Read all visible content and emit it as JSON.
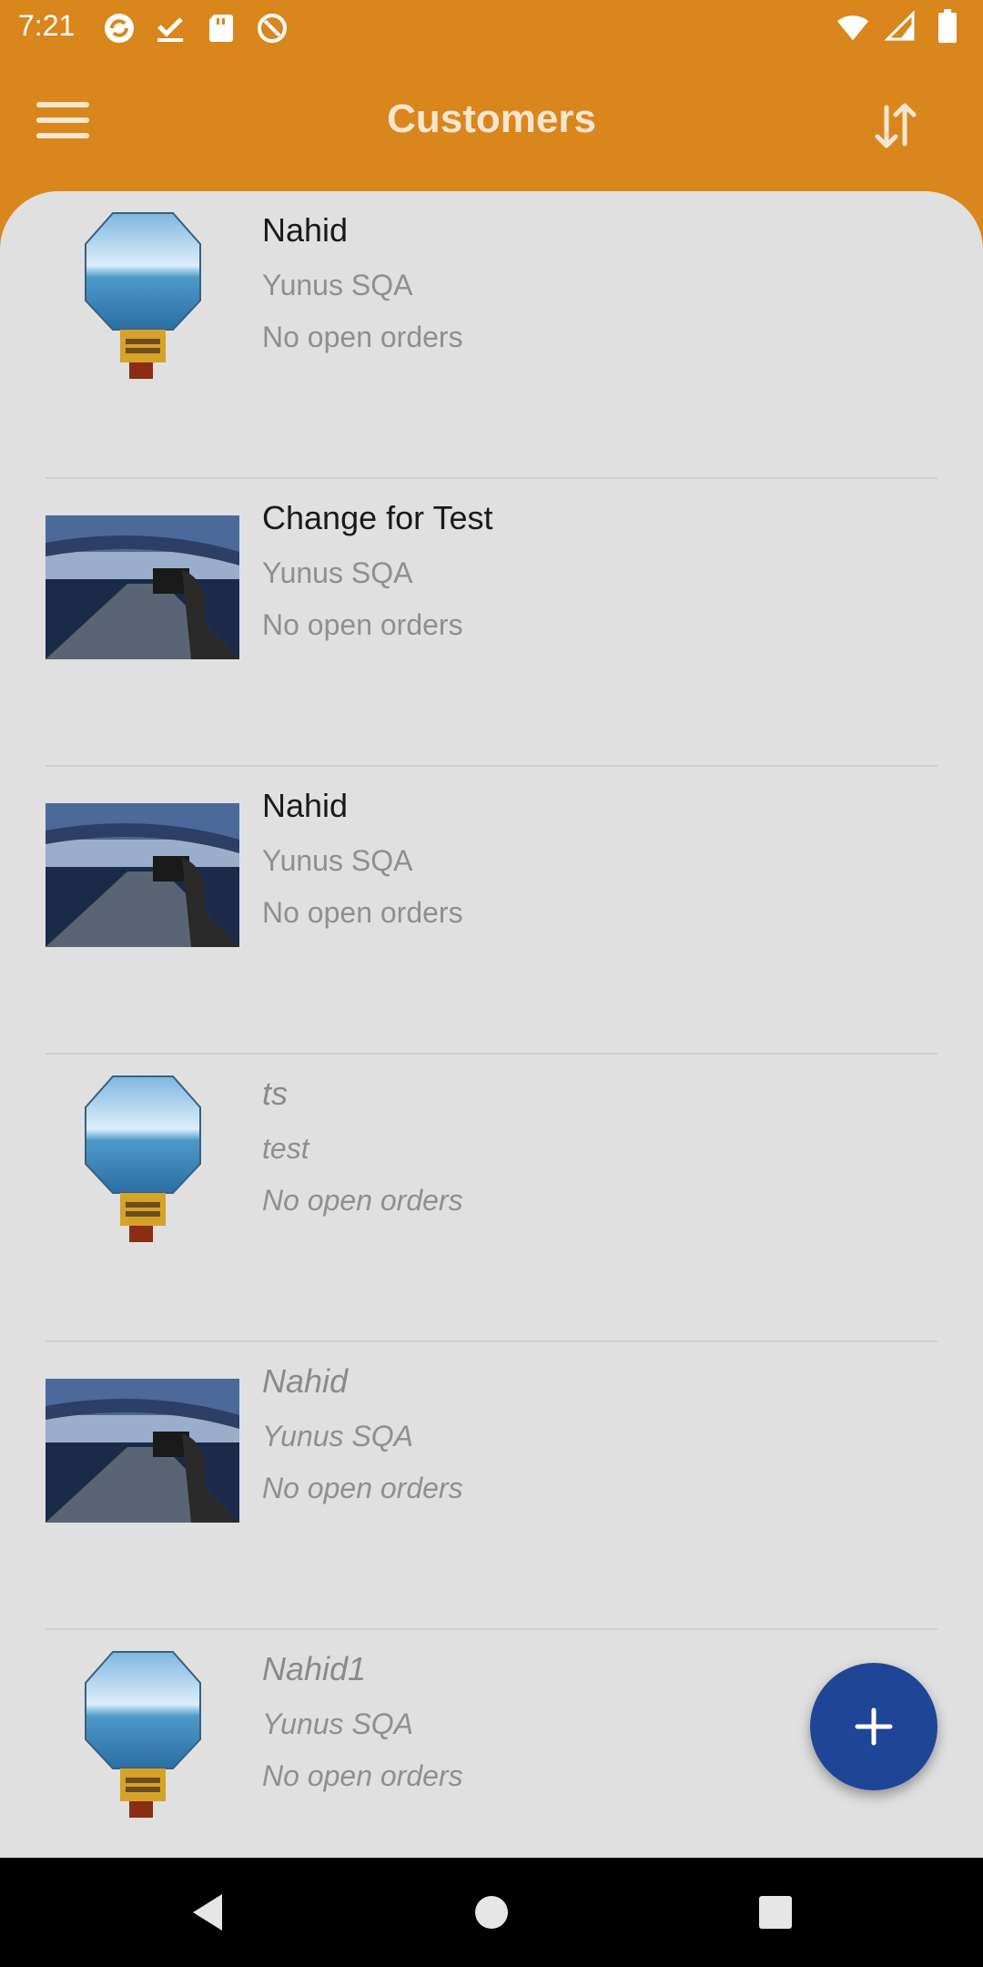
{
  "status_bar": {
    "time": "7:21",
    "left_icons": [
      "sync-icon",
      "checkmark-icon",
      "sd-card-icon",
      "at-sign-icon"
    ],
    "right_icons": [
      "wifi-icon",
      "signal-icon",
      "battery-icon"
    ]
  },
  "app_bar": {
    "title": "Customers",
    "menu_icon": "hamburger-menu-icon",
    "sort_icon": "sort-arrows-icon"
  },
  "customers": [
    {
      "name": "Nahid",
      "company": "Yunus SQA",
      "orders": "No open orders",
      "thumb": "screen-module",
      "italic": false
    },
    {
      "name": "Change for Test",
      "company": "Yunus SQA",
      "orders": "No open orders",
      "thumb": "bridge-photo",
      "italic": false
    },
    {
      "name": "Nahid",
      "company": "Yunus SQA",
      "orders": "No open orders",
      "thumb": "bridge-photo",
      "italic": false
    },
    {
      "name": "ts",
      "company": "test",
      "orders": "No open orders",
      "thumb": "screen-module",
      "italic": true
    },
    {
      "name": "Nahid",
      "company": "Yunus SQA",
      "orders": "No open orders",
      "thumb": "bridge-photo",
      "italic": true
    },
    {
      "name": "Nahid1",
      "company": "Yunus SQA",
      "orders": "No open orders",
      "thumb": "screen-module",
      "italic": true
    }
  ],
  "fab": {
    "icon": "plus-icon"
  },
  "colors": {
    "primary": "#d9861c",
    "fab": "#1f4596",
    "background": "#e0e0e0"
  }
}
